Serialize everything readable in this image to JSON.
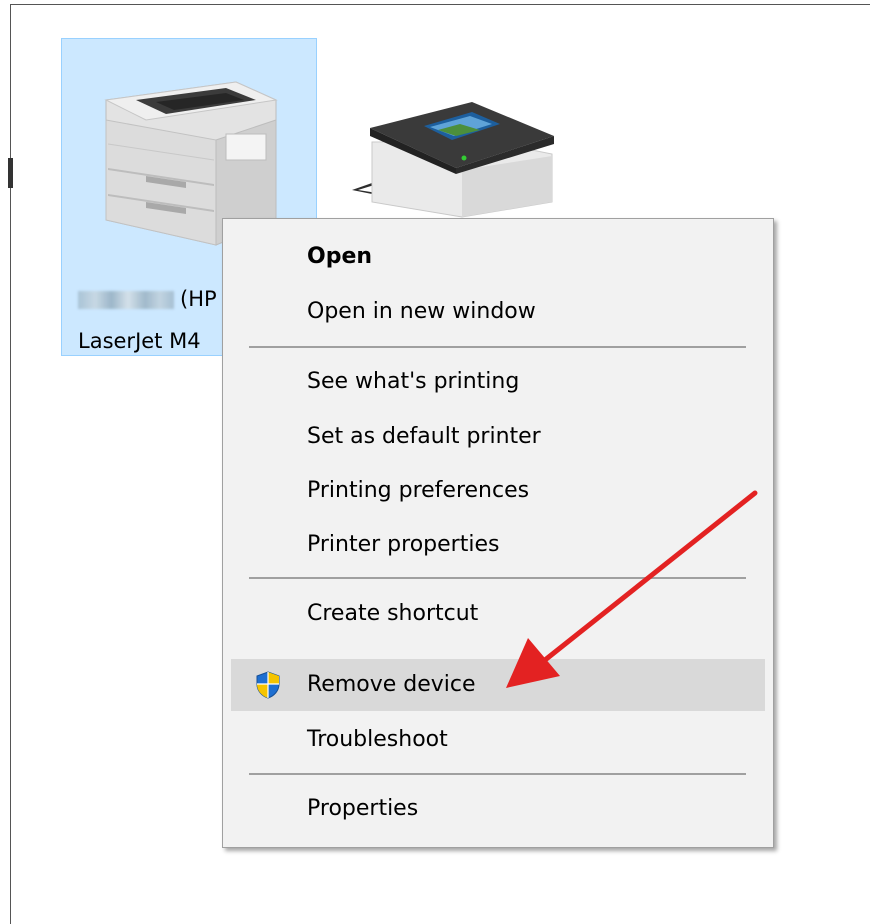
{
  "device": {
    "name_visible": "(HP",
    "model_visible": "LaserJet M4"
  },
  "context_menu": {
    "items": [
      {
        "label": "Open"
      },
      {
        "label": "Open in new window"
      },
      {
        "label": "See what's printing"
      },
      {
        "label": "Set as default printer"
      },
      {
        "label": "Printing preferences"
      },
      {
        "label": "Printer properties"
      },
      {
        "label": "Create shortcut"
      },
      {
        "label": "Remove device"
      },
      {
        "label": "Troubleshoot"
      },
      {
        "label": "Properties"
      }
    ],
    "highlighted": "Remove device"
  },
  "icons": {
    "device_1": "laserjet-printer-icon",
    "device_2": "generic-printer-icon",
    "remove_device": "uac-shield-icon",
    "annotation": "red-arrow"
  },
  "colors": {
    "selection_background": "#cce8ff",
    "selection_border": "#99d1ff",
    "menu_background": "#f2f2f2",
    "menu_highlight": "#d9d9d9",
    "arrow": "#e32222",
    "shield_blue": "#1e6fd1",
    "shield_yellow": "#f5c400"
  }
}
